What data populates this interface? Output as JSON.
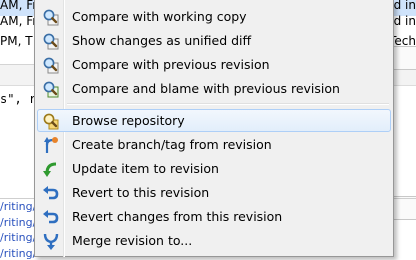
{
  "background": {
    "rows": [
      {
        "left": "AM, Fri",
        "right": "ed in"
      },
      {
        "left": "AM, Fri",
        "right": "ded in"
      },
      {
        "left": "PM, T",
        "right": "Tech"
      }
    ],
    "code_fragment": "s\", r",
    "links": [
      "/riting/",
      "/riting/",
      "/riting/",
      "/riting/"
    ]
  },
  "menu": {
    "items": [
      {
        "label": "Compare with working copy",
        "icon": "magnifier-diff-icon"
      },
      {
        "label": "Show changes as unified diff",
        "icon": "magnifier-diff-icon"
      },
      {
        "label": "Compare with previous revision",
        "icon": "magnifier-diff-icon"
      },
      {
        "label": "Compare and blame with previous revision",
        "icon": "magnifier-blame-icon"
      },
      {
        "label": "Browse repository",
        "icon": "repo-browser-icon"
      },
      {
        "label": "Create branch/tag from revision",
        "icon": "branch-tag-icon"
      },
      {
        "label": "Update item to revision",
        "icon": "update-icon"
      },
      {
        "label": "Revert to this revision",
        "icon": "revert-icon"
      },
      {
        "label": "Revert changes from this revision",
        "icon": "revert-changes-icon"
      },
      {
        "label": "Merge revision to...",
        "icon": "merge-icon"
      }
    ]
  }
}
